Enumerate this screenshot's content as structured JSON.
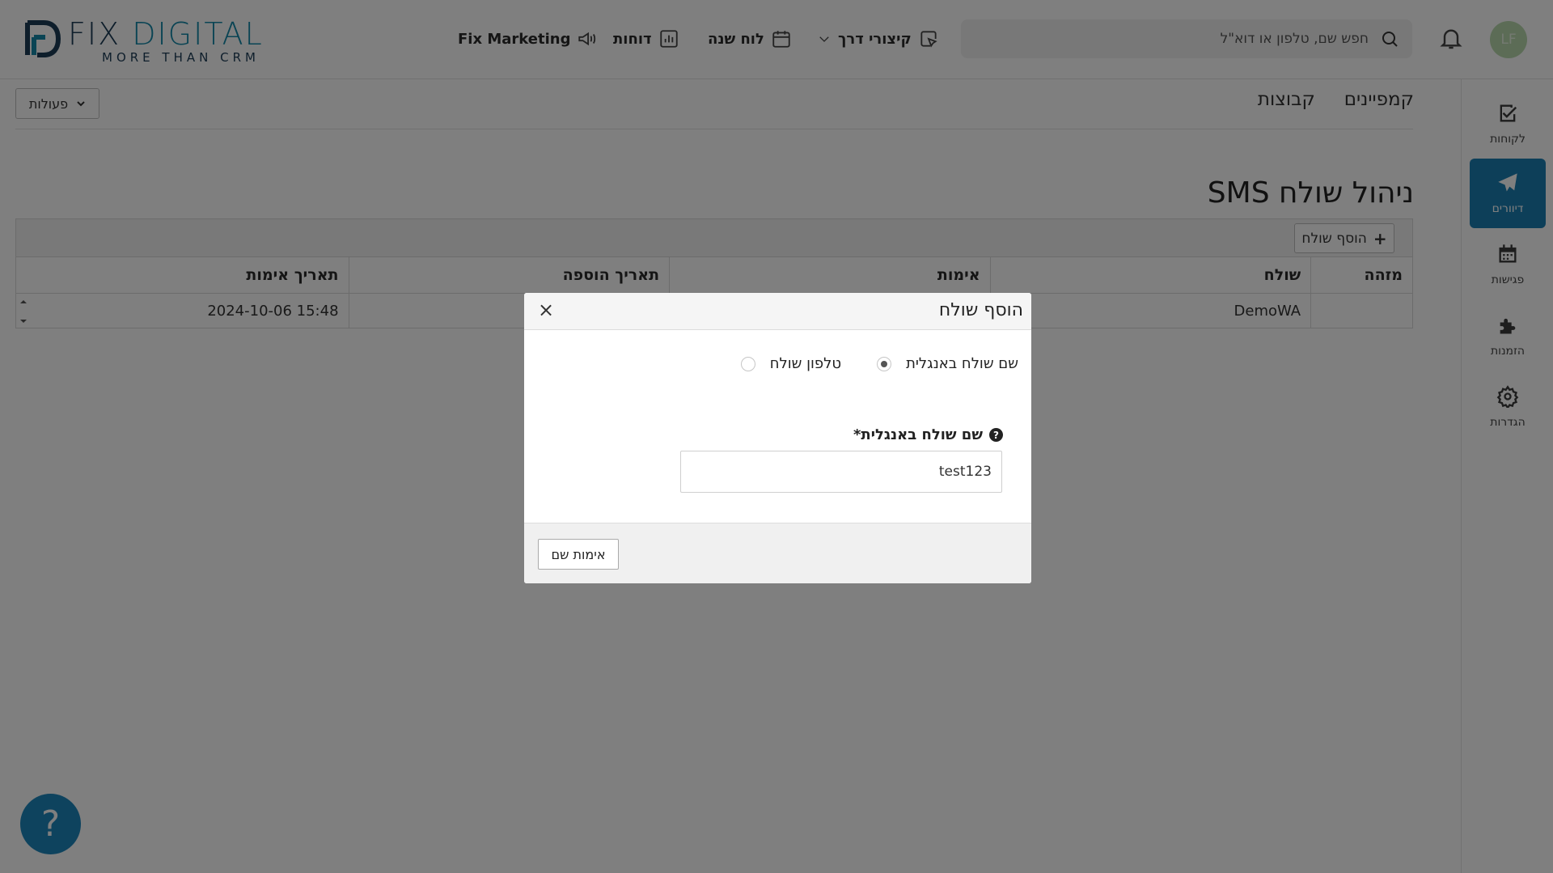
{
  "brand": {
    "name_part1": "FIX",
    "name_part2": "DIGITAL",
    "tagline": "MORE THAN CRM"
  },
  "header": {
    "nav": [
      {
        "label": "Fix Marketing",
        "icon": "megaphone-icon"
      },
      {
        "label": "דוחות",
        "icon": "bar-chart-icon"
      },
      {
        "label": "לוח שנה",
        "icon": "calendar-icon"
      },
      {
        "label": "קיצורי דרך",
        "icon": "cursor-click-icon",
        "dropdown": true
      }
    ],
    "search_placeholder": "חפש שם, טלפון או דוא\"ל",
    "avatar_initials": "LF"
  },
  "sidebar": {
    "items": [
      {
        "label": "לקוחות",
        "icon": "check-square-icon"
      },
      {
        "label": "דיוורים",
        "icon": "paper-plane-icon",
        "active": true
      },
      {
        "label": "פגישות",
        "icon": "calendar-grid-icon"
      },
      {
        "label": "הזמנות",
        "icon": "puzzle-icon"
      },
      {
        "label": "הגדרות",
        "icon": "gear-icon"
      }
    ]
  },
  "main": {
    "actions_label": "פעולות",
    "tabs": [
      "קמפיינים",
      "קבוצות"
    ],
    "page_title": "ניהול שולח SMS",
    "add_sender_label": "הוסף שולח",
    "table": {
      "columns": [
        "מזהה",
        "שולח",
        "אימות",
        "תאריך הוספה",
        "תאריך אימות"
      ],
      "rows": [
        [
          "",
          "DemoWA",
          "",
          "",
          "15:48 2024-10-06"
        ]
      ]
    }
  },
  "help_label": "?",
  "modal": {
    "title": "הוסף שולח",
    "close": "×",
    "radio_phone": "טלפון שולח",
    "radio_name": "שם שולח באנגלית",
    "selected": "name",
    "field_label": "שם שולח באנגלית*",
    "field_value": "test123",
    "verify_button": "אימות שם"
  },
  "colors": {
    "accent": "#1b7fb3",
    "brand_dark": "#1d3c57",
    "brand_light": "#1589a8",
    "avatar_bg": "#b8d9ad"
  }
}
